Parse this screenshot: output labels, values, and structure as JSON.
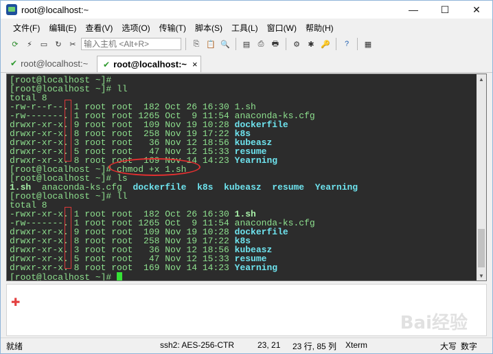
{
  "window": {
    "title": "root@localhost:~",
    "controls": [
      "—",
      "☐",
      "✕"
    ]
  },
  "menu": [
    "文件(F)",
    "编辑(E)",
    "查看(V)",
    "选项(O)",
    "传输(T)",
    "脚本(S)",
    "工具(L)",
    "窗口(W)",
    "帮助(H)"
  ],
  "toolbar": {
    "host_placeholder": "输入主机 <Alt+R>"
  },
  "tabs": [
    {
      "label": "root@localhost:~",
      "active": false
    },
    {
      "label": "root@localhost:~",
      "active": true,
      "close": "×"
    }
  ],
  "terminal": {
    "lines": [
      {
        "parts": [
          {
            "t": "[root@localhost ~]#",
            "c": "file"
          }
        ]
      },
      {
        "parts": [
          {
            "t": "[root@localhost ~]# ll",
            "c": "file"
          }
        ]
      },
      {
        "parts": [
          {
            "t": "total 8",
            "c": "file"
          }
        ]
      },
      {
        "parts": [
          {
            "t": "-rw-r--r--. 1 root root  182 Oct 26 16:30 1.sh",
            "c": "file"
          }
        ]
      },
      {
        "parts": [
          {
            "t": "-rw-------. 1 root root 1265 Oct  9 11:54 anaconda-ks.cfg",
            "c": "file"
          }
        ]
      },
      {
        "parts": [
          {
            "t": "drwxr-xr-x. 9 root root  109 Nov 19 10:28 ",
            "c": "file"
          },
          {
            "t": "dockerfile",
            "c": "dir"
          }
        ]
      },
      {
        "parts": [
          {
            "t": "drwxr-xr-x. 8 root root  258 Nov 19 17:22 ",
            "c": "file"
          },
          {
            "t": "k8s",
            "c": "dir"
          }
        ]
      },
      {
        "parts": [
          {
            "t": "drwxr-xr-x. 3 root root   36 Nov 12 18:56 ",
            "c": "file"
          },
          {
            "t": "kubeasz",
            "c": "dir"
          }
        ]
      },
      {
        "parts": [
          {
            "t": "drwxr-xr-x. 5 root root   47 Nov 12 15:33 ",
            "c": "file"
          },
          {
            "t": "resume",
            "c": "dir"
          }
        ]
      },
      {
        "parts": [
          {
            "t": "drwxr-xr-x. 8 root root  169 Nov 14 14:23 ",
            "c": "file"
          },
          {
            "t": "Yearning",
            "c": "dir"
          }
        ]
      },
      {
        "parts": [
          {
            "t": "[root@localhost ~]# chmod +x 1.sh",
            "c": "file"
          }
        ]
      },
      {
        "parts": [
          {
            "t": "[root@localhost ~]# ls",
            "c": "file"
          }
        ]
      },
      {
        "parts": [
          {
            "t": "1.sh",
            "c": "exec"
          },
          {
            "t": "  anaconda-ks.cfg  ",
            "c": "file"
          },
          {
            "t": "dockerfile  k8s  kubeasz  resume  Yearning",
            "c": "dir"
          }
        ]
      },
      {
        "parts": [
          {
            "t": "[root@localhost ~]# ll",
            "c": "file"
          }
        ]
      },
      {
        "parts": [
          {
            "t": "total 8",
            "c": "file"
          }
        ]
      },
      {
        "parts": [
          {
            "t": "-rwxr-xr-x. 1 root root  182 Oct 26 16:30 ",
            "c": "file"
          },
          {
            "t": "1.sh",
            "c": "exec"
          }
        ]
      },
      {
        "parts": [
          {
            "t": "-rw-------. 1 root root 1265 Oct  9 11:54 anaconda-ks.cfg",
            "c": "file"
          }
        ]
      },
      {
        "parts": [
          {
            "t": "drwxr-xr-x. 9 root root  109 Nov 19 10:28 ",
            "c": "file"
          },
          {
            "t": "dockerfile",
            "c": "dir"
          }
        ]
      },
      {
        "parts": [
          {
            "t": "drwxr-xr-x. 8 root root  258 Nov 19 17:22 ",
            "c": "file"
          },
          {
            "t": "k8s",
            "c": "dir"
          }
        ]
      },
      {
        "parts": [
          {
            "t": "drwxr-xr-x. 3 root root   36 Nov 12 18:56 ",
            "c": "file"
          },
          {
            "t": "kubeasz",
            "c": "dir"
          }
        ]
      },
      {
        "parts": [
          {
            "t": "drwxr-xr-x. 5 root root   47 Nov 12 15:33 ",
            "c": "file"
          },
          {
            "t": "resume",
            "c": "dir"
          }
        ]
      },
      {
        "parts": [
          {
            "t": "drwxr-xr-x. 8 root root  169 Nov 14 14:23 ",
            "c": "file"
          },
          {
            "t": "Yearning",
            "c": "dir"
          }
        ]
      },
      {
        "parts": [
          {
            "t": "[root@localhost ~]# ",
            "c": "file"
          }
        ],
        "cursor": true
      }
    ]
  },
  "watermark": "Bai经验",
  "statusbar": {
    "ready": "就绪",
    "session": "ssh2: AES-256-CTR",
    "cursor_pos": "23,  21",
    "size": "23 行, 85 列",
    "term_type": "Xterm",
    "caps": "大写",
    "num": "数字"
  },
  "colors": {
    "terminal_bg": "#2c2c2c",
    "terminal_fg": "#8ee08e",
    "dir": "#6ee3ee",
    "annotation": "#e03a3a"
  }
}
